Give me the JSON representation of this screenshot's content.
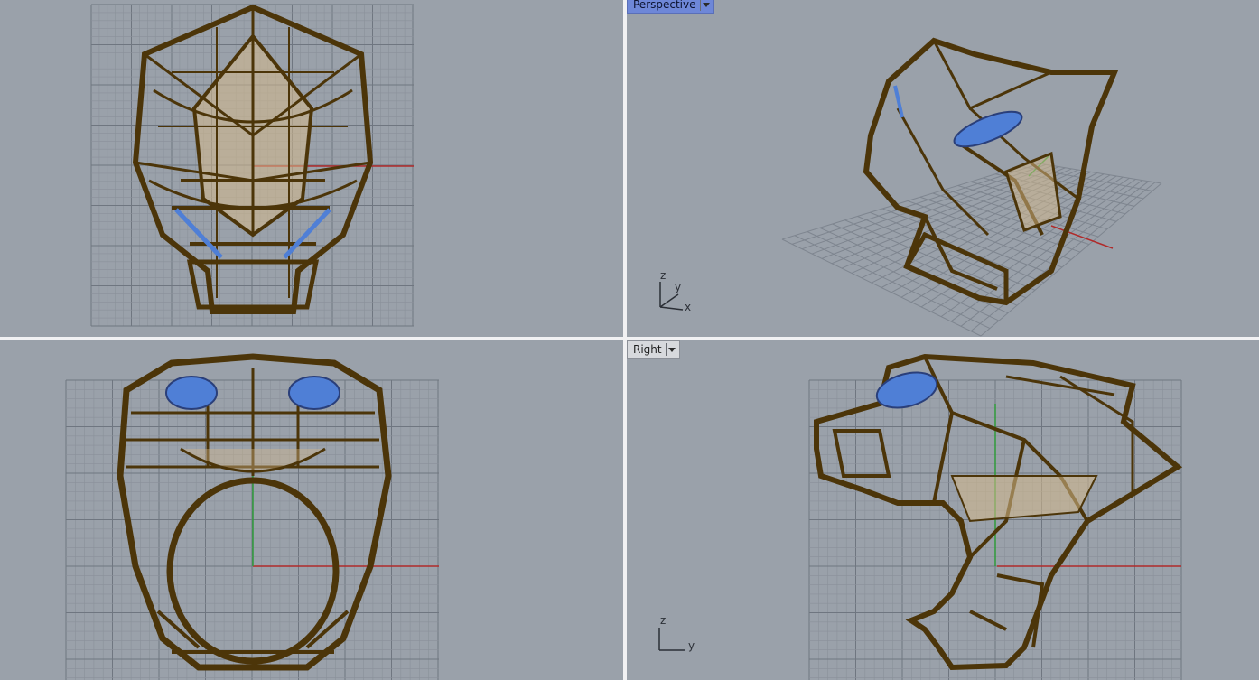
{
  "viewports": {
    "top": {
      "label": ""
    },
    "perspective": {
      "label": "Perspective"
    },
    "front": {
      "label": ""
    },
    "right": {
      "label": "Right"
    }
  },
  "axis_labels": {
    "perspective": {
      "z": "z",
      "y": "y",
      "x": "x"
    },
    "right": {
      "z": "z",
      "y": "y"
    }
  },
  "colors": {
    "background": "#9aa1aa",
    "grid": "#7e858f",
    "wireframe": "#4c3509",
    "fill": "#d6b98a",
    "gem": "#4f7fd6",
    "x_axis": "#b02a2a",
    "y_axis": "#2f9b3a",
    "active_tab": "#6e87d8"
  },
  "icons": {
    "viewport_menu": "chevron-down-icon"
  }
}
